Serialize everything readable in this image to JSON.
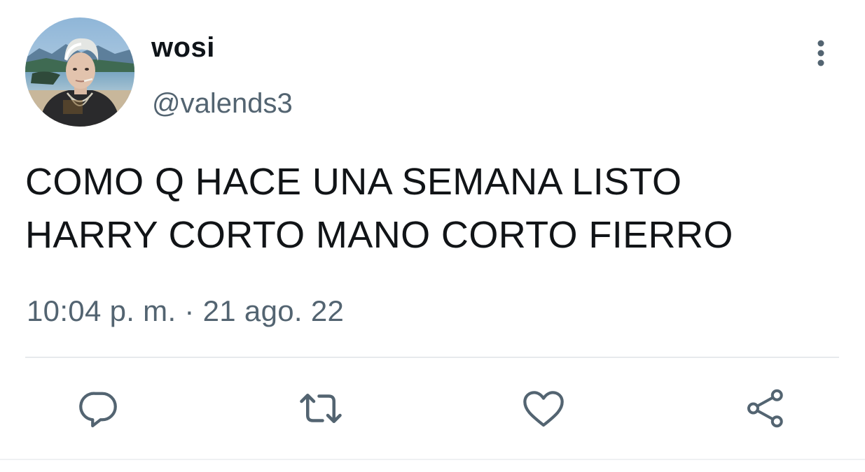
{
  "user": {
    "display_name": "wosi",
    "handle": "@valends3",
    "avatar_icon": "profile-photo-avatar"
  },
  "tweet": {
    "text": "COMO Q HACE UNA SEMANA LISTO\nHARRY CORTO MANO CORTO FIERRO",
    "timestamp": "10:04 p. m. · 21 ago. 22"
  },
  "actions": [
    {
      "name": "reply",
      "icon": "speech-bubble-icon"
    },
    {
      "name": "retweet",
      "icon": "retweet-arrows-icon"
    },
    {
      "name": "like",
      "icon": "heart-icon"
    },
    {
      "name": "share",
      "icon": "share-nodes-icon"
    }
  ],
  "colors": {
    "text_primary": "#0f1419",
    "text_secondary": "#536471",
    "icon": "#536471",
    "divider": "#e6e9ec",
    "background": "#ffffff"
  }
}
